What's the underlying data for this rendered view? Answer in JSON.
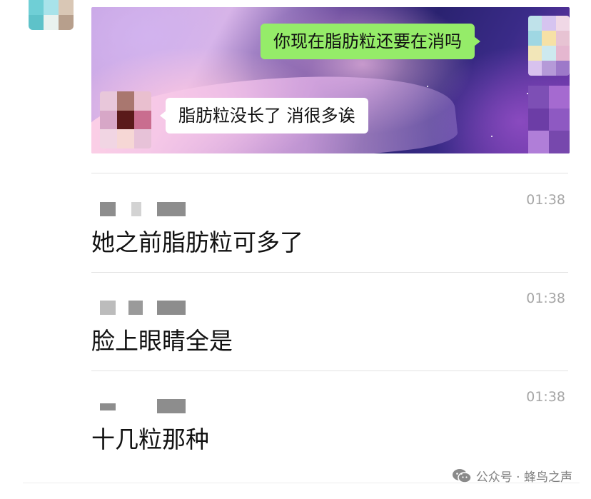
{
  "embedded_screenshot": {
    "sent_message": "你现在脂肪粒还要在消吗",
    "received_message": "脂肪粒没长了 消很多诶"
  },
  "messages": [
    {
      "time": "01:38",
      "text": "她之前脂肪粒可多了"
    },
    {
      "time": "01:38",
      "text": "脸上眼睛全是"
    },
    {
      "time": "01:38",
      "text": "十几粒那种"
    }
  ],
  "footer": {
    "icon": "wechat-icon",
    "label": "公众号 · 蜂鸟之声"
  },
  "colors": {
    "sent_bubble": "#95ec69",
    "received_bubble": "#ffffff",
    "timestamp": "#a6a6a6"
  }
}
